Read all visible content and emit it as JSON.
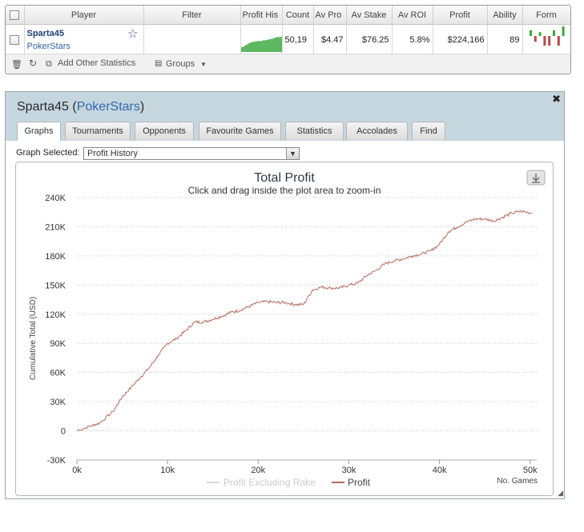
{
  "stats_table": {
    "headers": {
      "player": "Player",
      "filter": "Filter",
      "profit_history": "Profit His",
      "count": "Count",
      "av_profit": "Av Pro",
      "av_stake": "Av Stake",
      "av_roi": "Av ROI",
      "profit": "Profit",
      "ability": "Ability",
      "form": "Form"
    },
    "row": {
      "player_name": "Sparta45",
      "site": "PokerStars",
      "filter": "",
      "count": "50,19",
      "av_profit": "$4.47",
      "av_stake": "$76.25",
      "av_roi": "5.8%",
      "profit": "$224,166",
      "ability": "89",
      "form_bars": [
        {
          "color": "green",
          "value": 3
        },
        {
          "color": "red",
          "value": -3
        },
        {
          "color": "green",
          "value": 2
        },
        {
          "color": "red",
          "value": -5
        },
        {
          "color": "red",
          "value": -5
        },
        {
          "color": "green",
          "value": 3
        },
        {
          "color": "red",
          "value": -5
        },
        {
          "color": "green",
          "value": 5
        }
      ]
    },
    "toolbar": {
      "add_stats_label": "Add Other Statistics",
      "groups_label": "Groups"
    }
  },
  "profile_window": {
    "player_name": "Sparta45",
    "site": "PokerStars",
    "tabs": [
      "Graphs",
      "Tournaments",
      "Opponents",
      "Favourite Games",
      "Statistics",
      "Accolades",
      "Find"
    ],
    "active_tab": "Graphs",
    "graph_selected_label": "Graph Selected:",
    "graph_selected_value": "Profit History"
  },
  "colors": {
    "profit_line": "#b86b5e",
    "excluding_rake_line": "#d9d9d9",
    "sparkline_fill": "#4caf50",
    "form_green": "#3aaa35",
    "form_red": "#b94a48"
  },
  "chart_data": {
    "type": "line",
    "title": "Total Profit",
    "subtitle": "Click and drag inside the plot area to zoom-in",
    "xlabel": "No. Games",
    "ylabel": "Cumulative Total (USD)",
    "xlim": [
      0,
      50198
    ],
    "ylim": [
      -30000,
      240000
    ],
    "x_ticks": [
      "0k",
      "10k",
      "20k",
      "30k",
      "40k",
      "50k"
    ],
    "y_ticks": [
      "-30K",
      "0",
      "30K",
      "60K",
      "90K",
      "120K",
      "150K",
      "180K",
      "210K",
      "240K"
    ],
    "grid": "horizontal-dotted",
    "legend": "bottom-center",
    "series": [
      {
        "name": "Profit Excluding Rake",
        "values": []
      },
      {
        "name": "Profit",
        "x": [
          0,
          1500,
          2500,
          4000,
          5000,
          6000,
          7000,
          8000,
          9000,
          10000,
          11000,
          12000,
          13000,
          14000,
          15000,
          16000,
          17000,
          18000,
          19000,
          20000,
          21000,
          22000,
          23000,
          24000,
          25000,
          26000,
          27000,
          28000,
          29000,
          30000,
          31000,
          32000,
          33000,
          34000,
          35000,
          36000,
          37000,
          38000,
          39000,
          40000,
          41000,
          42000,
          43000,
          44000,
          45000,
          46000,
          47000,
          48000,
          49000,
          50198
        ],
        "values": [
          0,
          5000,
          8000,
          20000,
          35000,
          45000,
          55000,
          65000,
          78000,
          90000,
          95000,
          103000,
          112000,
          112000,
          115000,
          118000,
          122000,
          124000,
          128000,
          132000,
          133000,
          132000,
          132000,
          130000,
          130000,
          145000,
          148000,
          147000,
          147000,
          150000,
          152000,
          160000,
          165000,
          172000,
          175000,
          177000,
          180000,
          182000,
          185000,
          192000,
          205000,
          210000,
          215000,
          218000,
          218000,
          216000,
          220000,
          224000,
          226000,
          224000
        ]
      }
    ]
  }
}
